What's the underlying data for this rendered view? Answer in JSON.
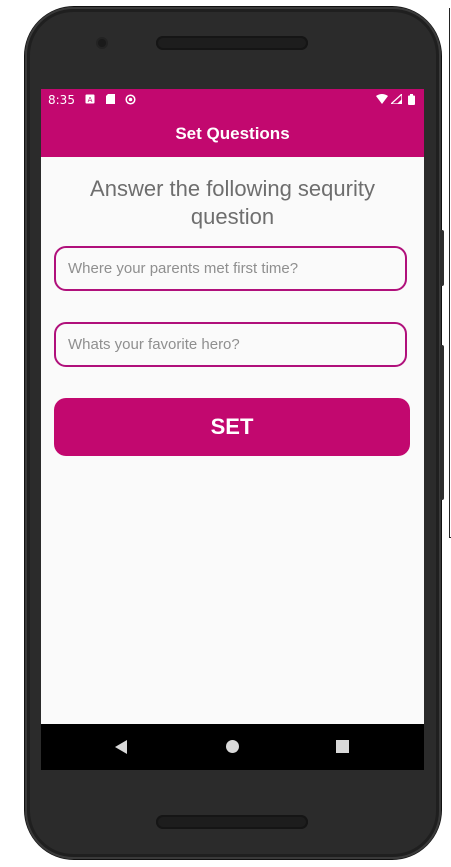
{
  "status_bar": {
    "time": "8:35",
    "left_icons": [
      "a-badge-icon",
      "sd-card-icon",
      "sync-icon"
    ],
    "right_icons": [
      "wifi-icon",
      "signal-icon",
      "battery-icon"
    ]
  },
  "app_bar": {
    "title": "Set Questions",
    "color": "#c2086f"
  },
  "main": {
    "heading": "Answer the following sequrity question",
    "fields": [
      {
        "placeholder": "Where your parents met first time?",
        "value": ""
      },
      {
        "placeholder": "Whats your favorite hero?",
        "value": ""
      }
    ],
    "submit_label": "SET"
  },
  "nav_bar": {
    "icons": [
      "back-icon",
      "home-icon",
      "recents-icon"
    ]
  },
  "colors": {
    "accent": "#c2086f",
    "field_border": "#b0107b",
    "heading_text": "#6e6e6e",
    "background": "#fafafa"
  }
}
